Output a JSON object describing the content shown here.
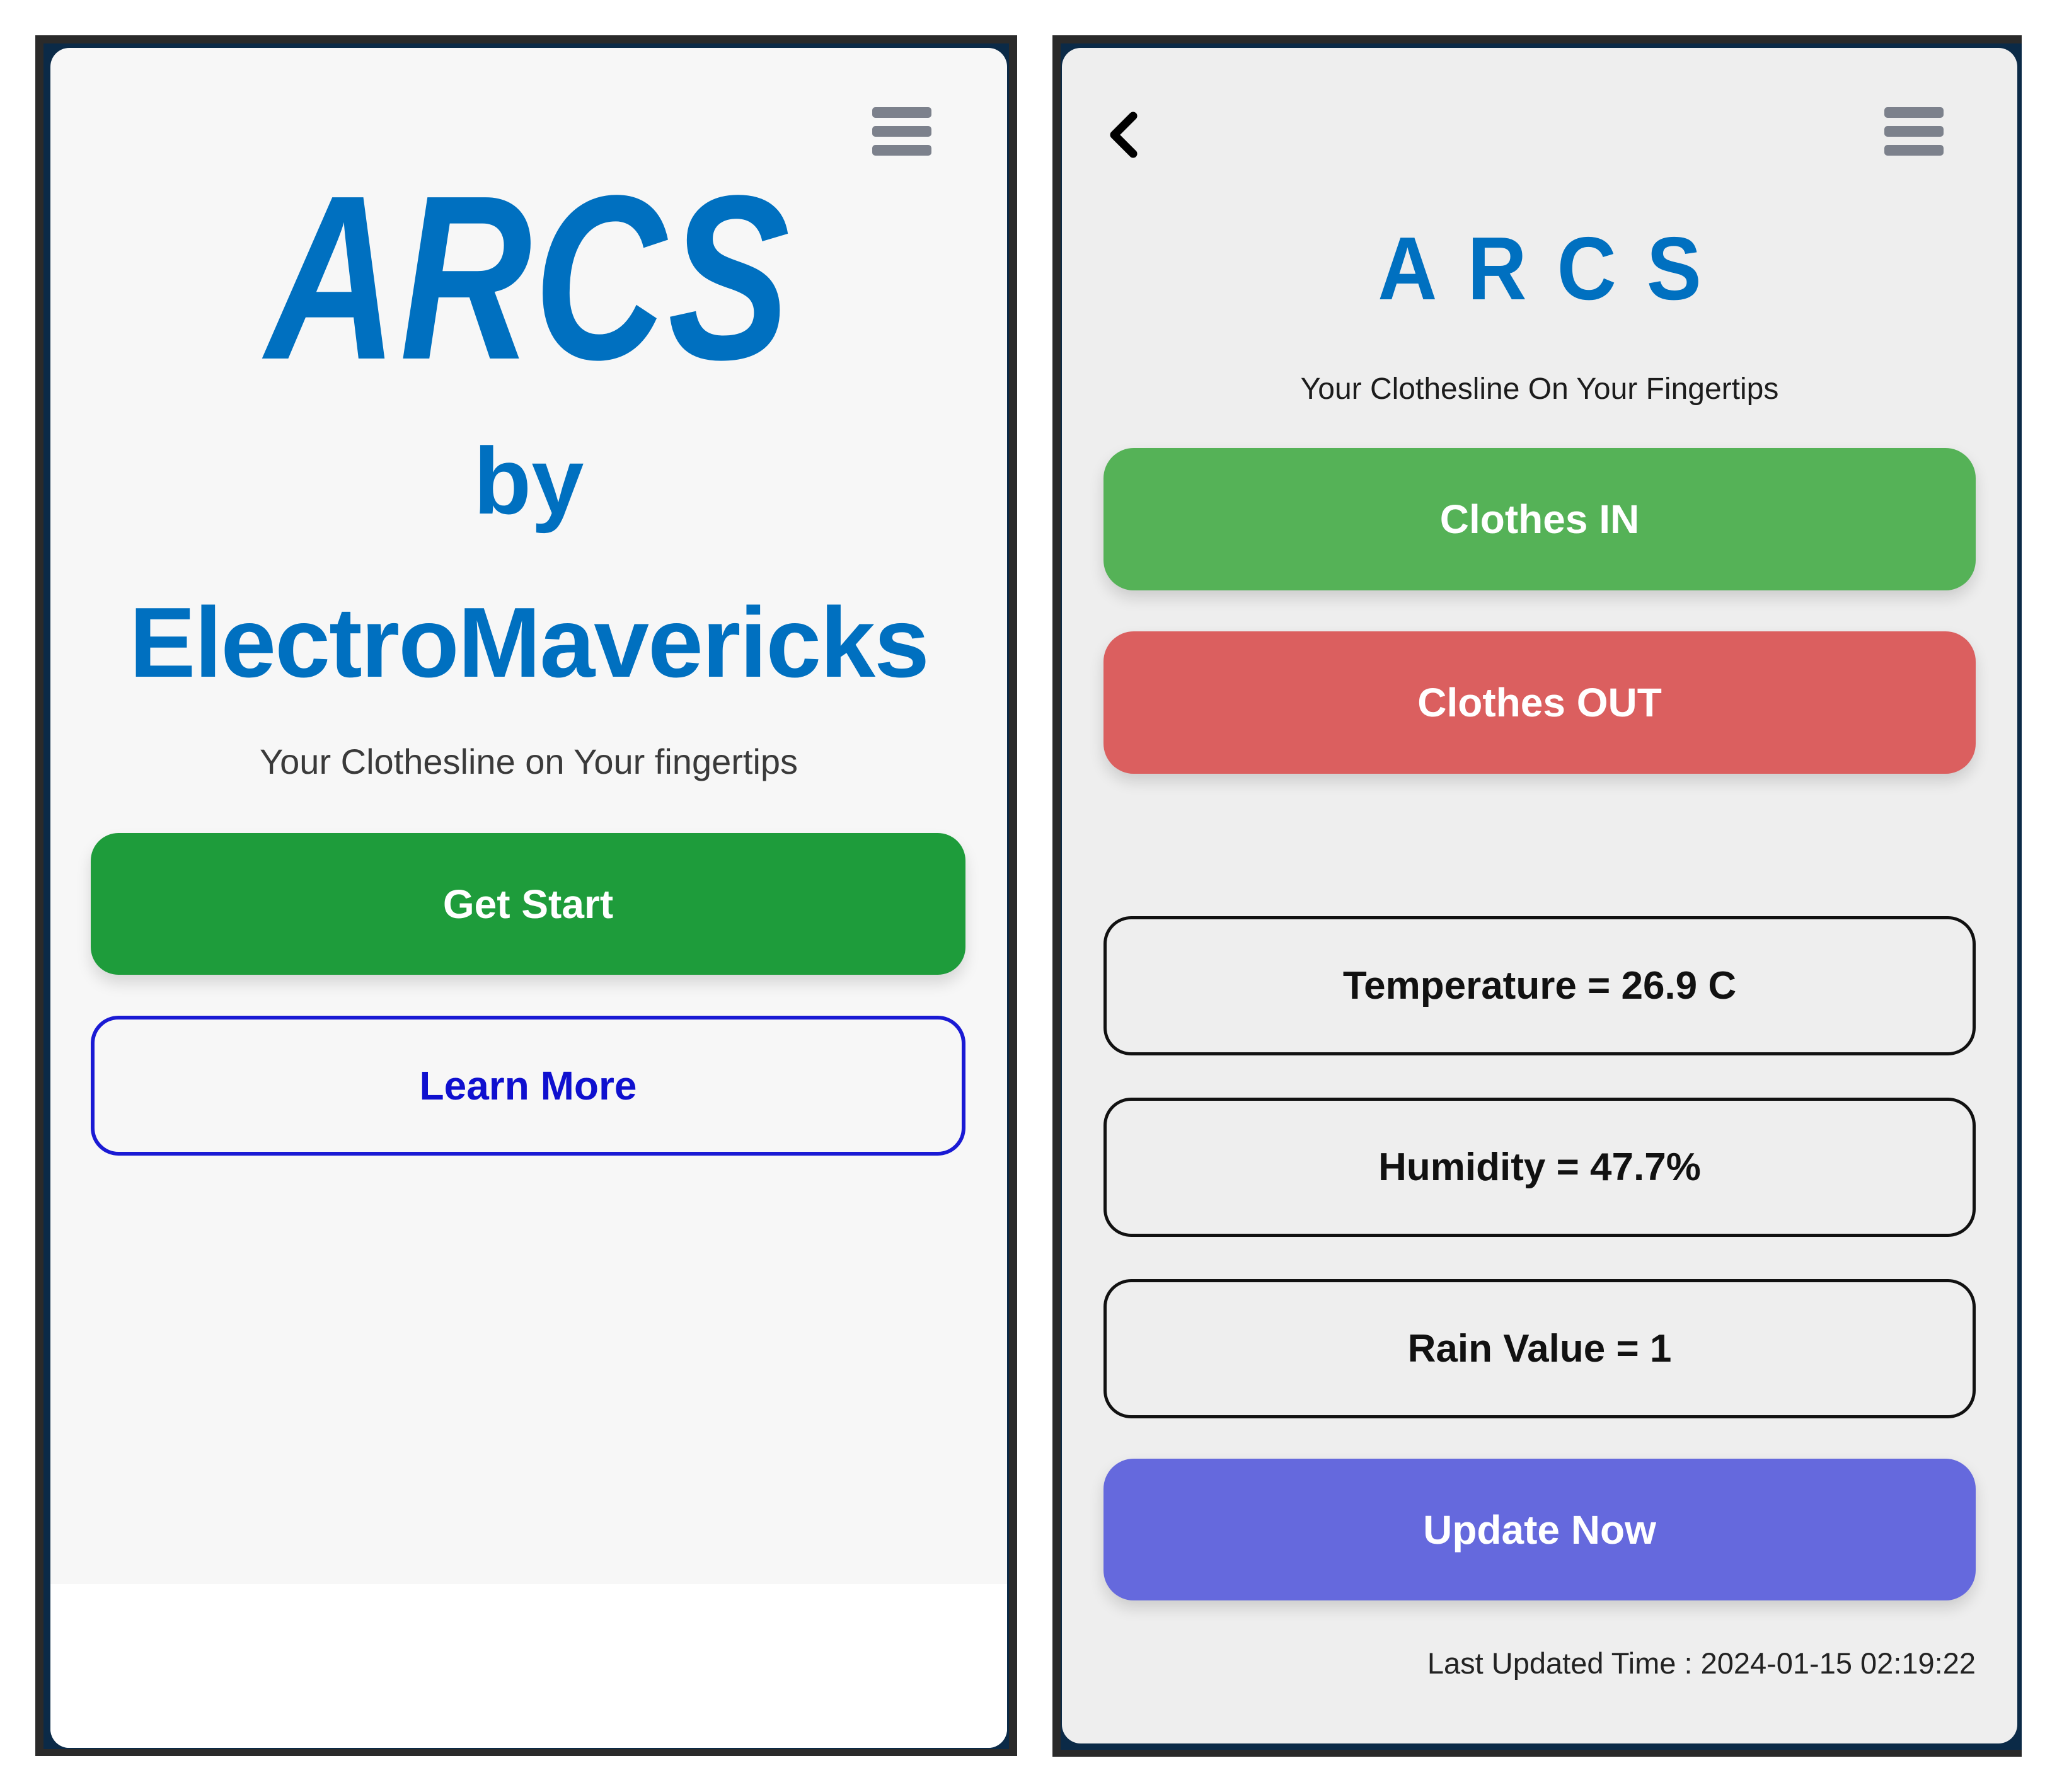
{
  "colors": {
    "brand_blue": "#0070c0",
    "get_start_green": "#1e9c3b",
    "learn_more_blue": "#0f10cf",
    "clothes_in_green": "#55b257",
    "clothes_out_red": "#db5f5f",
    "update_now_purple": "#6569dd",
    "menu_gray": "#7c818c",
    "frame_navy": "#0b2a47"
  },
  "landing": {
    "menu_icon": "hamburger-menu-icon",
    "logo": "ARCS",
    "by": "by",
    "brand": "ElectroMavericks",
    "tagline": "Your Clothesline on Your fingertips",
    "get_start_label": "Get Start",
    "learn_more_label": "Learn More"
  },
  "dashboard": {
    "back_icon": "chevron-left-icon",
    "menu_icon": "hamburger-menu-icon",
    "logo": "ARCS",
    "tagline": "Your Clothesline On Your Fingertips",
    "clothes_in_label": "Clothes IN",
    "clothes_out_label": "Clothes OUT",
    "readings": {
      "temperature": "Temperature = 26.9 C",
      "humidity": "Humidity = 47.7%",
      "rain": "Rain Value = 1"
    },
    "update_now_label": "Update Now",
    "last_updated_label": "Last Updated Time : ",
    "last_updated_value": "2024-01-15 02:19:22"
  }
}
